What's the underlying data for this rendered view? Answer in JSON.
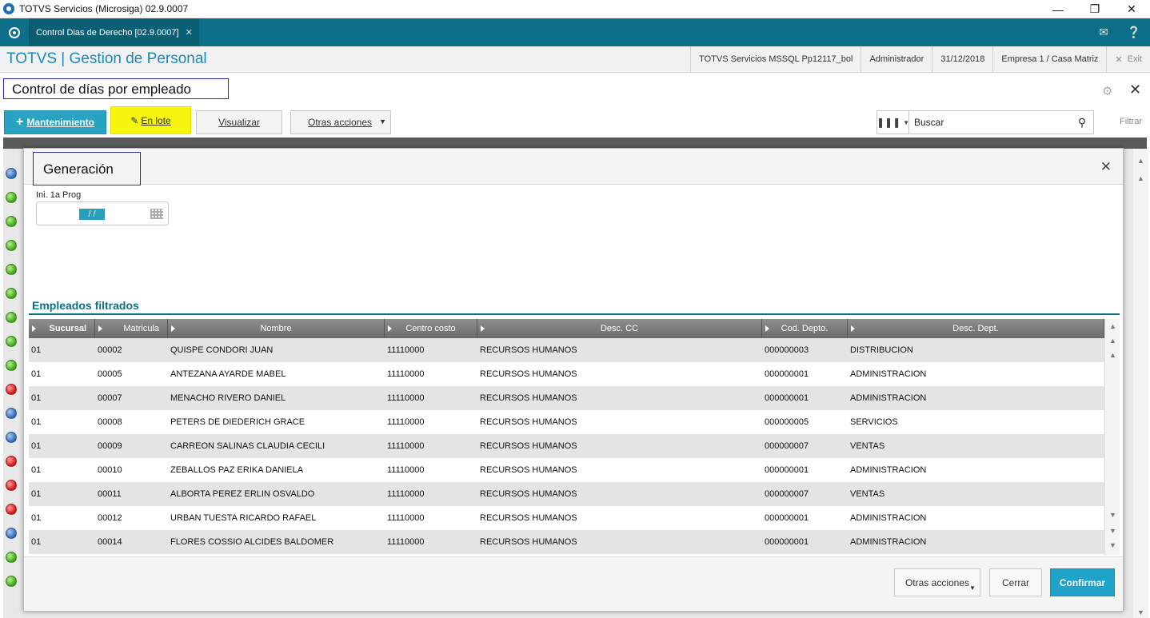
{
  "window": {
    "title": "TOTVS Servicios (Microsiga) 02.9.0007"
  },
  "tab": {
    "label": "Control Dias de Derecho [02.9.0007]"
  },
  "header": {
    "brand": "TOTVS | Gestion de Personal",
    "environment": "TOTVS Servicios MSSQL Pp12117_bol",
    "user": "Administrador",
    "date": "31/12/2018",
    "company": "Empresa 1 / Casa Matriz",
    "exit": "Exit"
  },
  "page": {
    "title": "Control de días por empleado"
  },
  "toolbar": {
    "mantenimiento": "Mantenimiento",
    "en_lote": "En lote",
    "visualizar": "Visualizar",
    "otras_acciones": "Otras acciones",
    "search_value": "Buscar",
    "filtrar": "Filtrar"
  },
  "background_status": [
    "blue",
    "green",
    "green",
    "green",
    "green",
    "green",
    "green",
    "green",
    "green",
    "red",
    "blue",
    "blue",
    "red",
    "red",
    "red",
    "blue",
    "green",
    "green"
  ],
  "modal": {
    "title": "Generación",
    "field_label": "Ini. 1a Prog",
    "field_value": " / /",
    "section_title": "Empleados filtrados",
    "columns": [
      "Sucursal",
      "Matricula",
      "Nombre",
      "Centro costo",
      "Desc. CC",
      "Cod. Depto.",
      "Desc. Dept."
    ],
    "rows": [
      [
        "01",
        "00002",
        "QUISPE CONDORI JUAN",
        "11110000",
        "RECURSOS HUMANOS",
        "000000003",
        "DISTRIBUCION"
      ],
      [
        "01",
        "00005",
        "ANTEZANA AYARDE MABEL",
        "11110000",
        "RECURSOS HUMANOS",
        "000000001",
        "ADMINISTRACION"
      ],
      [
        "01",
        "00007",
        "MENACHO RIVERO DANIEL",
        "11110000",
        "RECURSOS HUMANOS",
        "000000001",
        "ADMINISTRACION"
      ],
      [
        "01",
        "00008",
        "PETERS DE DIEDERICH GRACE",
        "11110000",
        "RECURSOS HUMANOS",
        "000000005",
        "SERVICIOS"
      ],
      [
        "01",
        "00009",
        "CARREON SALINAS CLAUDIA CECILI",
        "11110000",
        "RECURSOS HUMANOS",
        "000000007",
        "VENTAS"
      ],
      [
        "01",
        "00010",
        "ZEBALLOS PAZ ERIKA DANIELA",
        "11110000",
        "RECURSOS HUMANOS",
        "000000001",
        "ADMINISTRACION"
      ],
      [
        "01",
        "00011",
        "ALBORTA PEREZ ERLIN OSVALDO",
        "11110000",
        "RECURSOS HUMANOS",
        "000000007",
        "VENTAS"
      ],
      [
        "01",
        "00012",
        "URBAN TUESTA RICARDO RAFAEL",
        "11110000",
        "RECURSOS HUMANOS",
        "000000001",
        "ADMINISTRACION"
      ],
      [
        "01",
        "00014",
        "FLORES COSSIO ALCIDES BALDOMER",
        "11110000",
        "RECURSOS HUMANOS",
        "000000001",
        "ADMINISTRACION"
      ]
    ],
    "footer": {
      "otras_acciones": "Otras acciones",
      "cerrar": "Cerrar",
      "confirmar": "Confirmar"
    }
  }
}
